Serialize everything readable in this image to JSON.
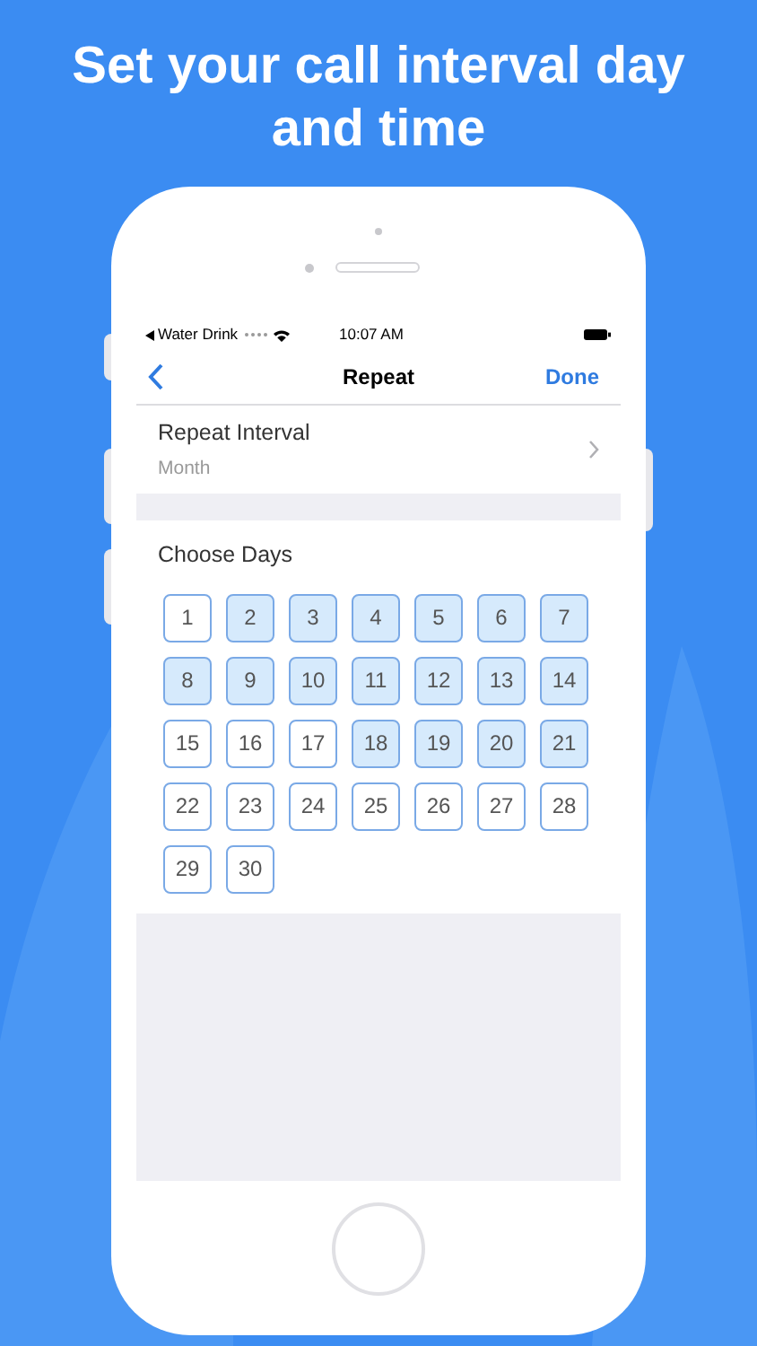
{
  "headline": "Set your call interval day and time",
  "status_bar": {
    "app": "Water Drink",
    "time": "10:07 AM"
  },
  "nav": {
    "title": "Repeat",
    "action": "Done"
  },
  "repeat_interval": {
    "label": "Repeat Interval",
    "value": "Month"
  },
  "days_section": {
    "title": "Choose Days",
    "days": [
      {
        "label": "1",
        "selected": false
      },
      {
        "label": "2",
        "selected": true
      },
      {
        "label": "3",
        "selected": true
      },
      {
        "label": "4",
        "selected": true
      },
      {
        "label": "5",
        "selected": true
      },
      {
        "label": "6",
        "selected": true
      },
      {
        "label": "7",
        "selected": true
      },
      {
        "label": "8",
        "selected": true
      },
      {
        "label": "9",
        "selected": true
      },
      {
        "label": "10",
        "selected": true
      },
      {
        "label": "11",
        "selected": true
      },
      {
        "label": "12",
        "selected": true
      },
      {
        "label": "13",
        "selected": true
      },
      {
        "label": "14",
        "selected": true
      },
      {
        "label": "15",
        "selected": false
      },
      {
        "label": "16",
        "selected": false
      },
      {
        "label": "17",
        "selected": false
      },
      {
        "label": "18",
        "selected": true
      },
      {
        "label": "19",
        "selected": true
      },
      {
        "label": "20",
        "selected": true
      },
      {
        "label": "21",
        "selected": true
      },
      {
        "label": "22",
        "selected": false
      },
      {
        "label": "23",
        "selected": false
      },
      {
        "label": "24",
        "selected": false
      },
      {
        "label": "25",
        "selected": false
      },
      {
        "label": "26",
        "selected": false
      },
      {
        "label": "27",
        "selected": false
      },
      {
        "label": "28",
        "selected": false
      },
      {
        "label": "29",
        "selected": false
      },
      {
        "label": "30",
        "selected": false
      }
    ]
  }
}
